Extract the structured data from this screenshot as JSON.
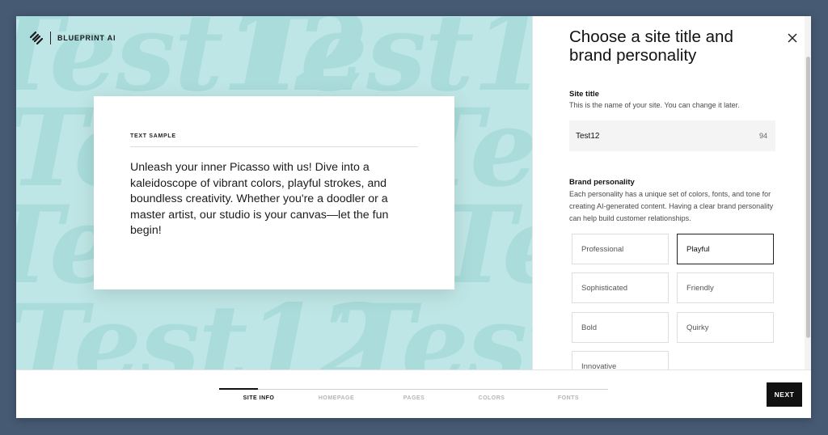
{
  "brand": {
    "name": "BLUEPRINT AI",
    "icon": "squarespace-logo-icon"
  },
  "preview": {
    "background_word": "Test12",
    "background_color": "#bfe6e6",
    "sample_label": "TEXT SAMPLE",
    "sample_text": "Unleash your inner Picasso with us! Dive into a kaleidoscope of vibrant colors, playful strokes, and boundless creativity. Whether you're a doodler or a master artist, our studio is your canvas—let the fun begin!"
  },
  "panel": {
    "title": "Choose a site title and brand personality",
    "close_icon": "close-icon",
    "site_title": {
      "label": "Site title",
      "help": "This is the name of your site. You can change it later.",
      "value": "Test12",
      "remaining_chars": "94"
    },
    "personality": {
      "label": "Brand personality",
      "help": "Each personality has a unique set of colors, fonts, and tone for creating AI-generated content. Having a clear brand personality can help build customer relationships.",
      "options": [
        "Professional",
        "Playful",
        "Sophisticated",
        "Friendly",
        "Bold",
        "Quirky",
        "Innovative"
      ],
      "selected": "Playful"
    }
  },
  "footer": {
    "steps": [
      "SITE INFO",
      "HOMEPAGE",
      "PAGES",
      "COLORS",
      "FONTS"
    ],
    "active_step": "SITE INFO",
    "progress_fraction": 0.1,
    "next_label": "NEXT"
  },
  "colors": {
    "page_background": "#465a73",
    "accent_dark": "#111111",
    "preview_background": "#bfe6e6",
    "preview_pattern": "#a9dcdb"
  }
}
